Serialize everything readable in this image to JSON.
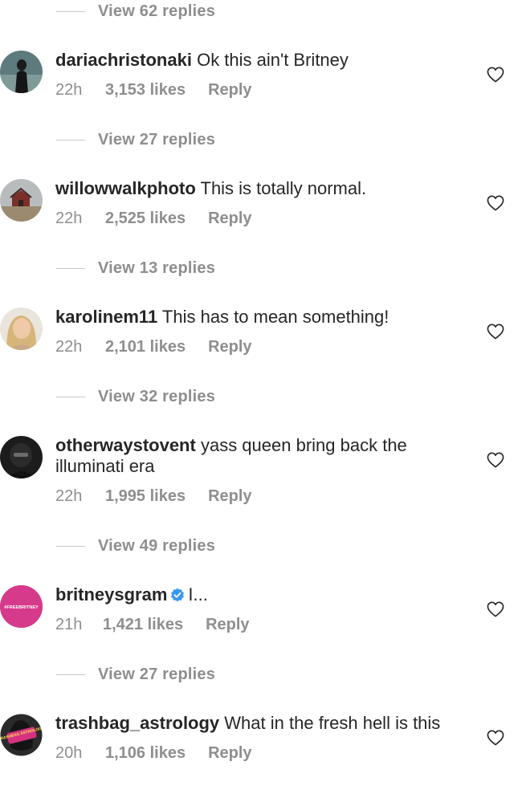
{
  "comments": [
    {
      "username": "dariachristonaki",
      "text": "Ok this ain't Britney",
      "time": "22h",
      "likes": "3,153 likes",
      "reply": "Reply",
      "view_replies": "View 27 replies"
    },
    {
      "username": "willowwalkphoto",
      "text": "This is totally normal.",
      "time": "22h",
      "likes": "2,525 likes",
      "reply": "Reply",
      "view_replies": "View 13 replies"
    },
    {
      "username": "karolinem11",
      "text": "This has to mean something!",
      "time": "22h",
      "likes": "2,101 likes",
      "reply": "Reply",
      "view_replies": "View 32 replies"
    },
    {
      "username": "otherwaystovent",
      "text": "yass queen bring back the illuminati era",
      "time": "22h",
      "likes": "1,995 likes",
      "reply": "Reply",
      "view_replies": "View 49 replies"
    },
    {
      "username": "britneysgram",
      "text": "I...",
      "time": "21h",
      "likes": "1,421 likes",
      "reply": "Reply",
      "view_replies": "View 27 replies",
      "verified": true,
      "avatar_text": "#FREEBRITNEY"
    },
    {
      "username": "trashbag_astrology",
      "text": "What in the fresh hell is this",
      "time": "20h",
      "likes": "1,106 likes",
      "reply": "Reply",
      "avatar_text": "TRASHBAG ASTROLOGY"
    }
  ],
  "top_view_replies": "View 62 replies",
  "colors": {
    "text": "#262626",
    "secondary": "#8e8e8e",
    "verified": "#3897f0",
    "britney_avatar": "#d63384"
  },
  "icons": {
    "like": "heart-outline-icon",
    "verified": "verified-badge-icon"
  }
}
